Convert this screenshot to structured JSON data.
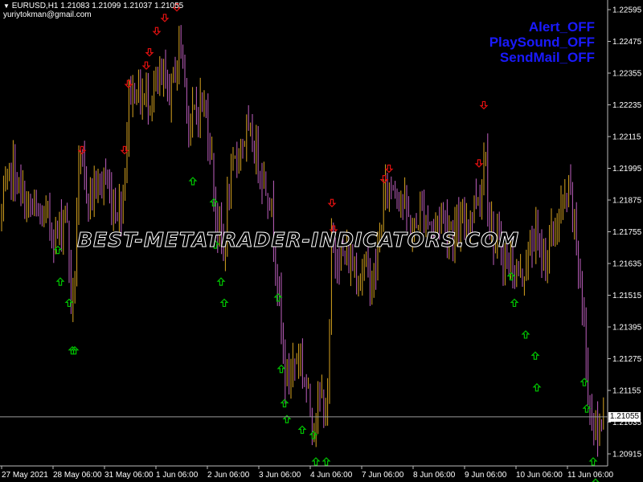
{
  "header": {
    "symbol_line": "EURUSD,H1  1.21083 1.21099 1.21037 1.21055",
    "account": "yuriytokman@gmail.com"
  },
  "alerts": {
    "alert": "Alert_OFF",
    "sound": "PlaySound_OFF",
    "mail": "SendMail_OFF"
  },
  "watermark": "BEST-METATRADER-INDICATORS.COM",
  "current_price": "1.21055",
  "colors": {
    "background": "#000000",
    "bull": "#d9a520",
    "bear": "#c060c0",
    "up_arrow": "#00c000",
    "down_arrow": "#e01010",
    "alert_text": "#1a1aff",
    "price_line": "#9a9a9a"
  },
  "chart_data": {
    "type": "candlestick",
    "symbol": "EURUSD",
    "timeframe": "H1",
    "ylim": [
      1.2085,
      1.2265
    ],
    "price_ticks": [
      "1.22595",
      "1.22475",
      "1.22355",
      "1.22235",
      "1.22115",
      "1.21995",
      "1.21875",
      "1.21755",
      "1.21635",
      "1.21515",
      "1.21395",
      "1.21275",
      "1.21155",
      "1.21035",
      "1.20915"
    ],
    "x_ticks": [
      "27 May 2021",
      "28 May 06:00",
      "31 May 06:00",
      "1 Jun 06:00",
      "2 Jun 06:00",
      "3 Jun 06:00",
      "4 Jun 06:00",
      "7 Jun 06:00",
      "8 Jun 06:00",
      "9 Jun 06:00",
      "10 Jun 06:00",
      "11 Jun 06:00"
    ],
    "close_path": [
      [
        0,
        1.218
      ],
      [
        8,
        1.219
      ],
      [
        15,
        1.22
      ],
      [
        25,
        1.219
      ],
      [
        35,
        1.2185
      ],
      [
        48,
        1.2181
      ],
      [
        60,
        1.218
      ],
      [
        70,
        1.2174
      ],
      [
        76,
        1.2178
      ],
      [
        81,
        1.2187
      ],
      [
        86,
        1.2165
      ],
      [
        90,
        1.2143
      ],
      [
        93,
        1.216
      ],
      [
        97,
        1.2196
      ],
      [
        102,
        1.2199
      ],
      [
        110,
        1.219
      ],
      [
        120,
        1.2192
      ],
      [
        130,
        1.2196
      ],
      [
        140,
        1.2186
      ],
      [
        150,
        1.2184
      ],
      [
        156,
        1.22
      ],
      [
        160,
        1.2228
      ],
      [
        170,
        1.223
      ],
      [
        178,
        1.2225
      ],
      [
        188,
        1.2228
      ],
      [
        196,
        1.223
      ],
      [
        204,
        1.2232
      ],
      [
        212,
        1.2228
      ],
      [
        220,
        1.224
      ],
      [
        226,
        1.2248
      ],
      [
        230,
        1.2232
      ],
      [
        236,
        1.2214
      ],
      [
        242,
        1.222
      ],
      [
        250,
        1.2225
      ],
      [
        258,
        1.2218
      ],
      [
        264,
        1.22
      ],
      [
        268,
        1.2184
      ],
      [
        272,
        1.2176
      ],
      [
        278,
        1.2168
      ],
      [
        284,
        1.2188
      ],
      [
        290,
        1.2198
      ],
      [
        298,
        1.2208
      ],
      [
        306,
        1.2212
      ],
      [
        316,
        1.2208
      ],
      [
        326,
        1.2198
      ],
      [
        336,
        1.2188
      ],
      [
        344,
        1.2164
      ],
      [
        350,
        1.2137
      ],
      [
        356,
        1.2119
      ],
      [
        364,
        1.2125
      ],
      [
        372,
        1.213
      ],
      [
        380,
        1.2118
      ],
      [
        388,
        1.2106
      ],
      [
        394,
        1.2106
      ],
      [
        400,
        1.2114
      ],
      [
        404,
        1.2108
      ],
      [
        408,
        1.2108
      ],
      [
        412,
        1.217
      ],
      [
        418,
        1.2168
      ],
      [
        426,
        1.2166
      ],
      [
        436,
        1.2164
      ],
      [
        446,
        1.216
      ],
      [
        456,
        1.2162
      ],
      [
        464,
        1.2156
      ],
      [
        470,
        1.2166
      ],
      [
        476,
        1.2186
      ],
      [
        482,
        1.2192
      ],
      [
        490,
        1.2194
      ],
      [
        498,
        1.219
      ],
      [
        508,
        1.218
      ],
      [
        516,
        1.2174
      ],
      [
        522,
        1.2184
      ],
      [
        530,
        1.2182
      ],
      [
        540,
        1.2176
      ],
      [
        548,
        1.2184
      ],
      [
        556,
        1.2178
      ],
      [
        564,
        1.2176
      ],
      [
        572,
        1.2176
      ],
      [
        580,
        1.218
      ],
      [
        588,
        1.2184
      ],
      [
        594,
        1.219
      ],
      [
        600,
        1.2192
      ],
      [
        604,
        1.2214
      ],
      [
        608,
        1.218
      ],
      [
        616,
        1.2172
      ],
      [
        624,
        1.2168
      ],
      [
        632,
        1.2164
      ],
      [
        640,
        1.2162
      ],
      [
        648,
        1.2158
      ],
      [
        654,
        1.2164
      ],
      [
        660,
        1.2168
      ],
      [
        666,
        1.2176
      ],
      [
        672,
        1.2166
      ],
      [
        680,
        1.2168
      ],
      [
        690,
        1.2176
      ],
      [
        700,
        1.2184
      ],
      [
        708,
        1.219
      ],
      [
        714,
        1.218
      ],
      [
        720,
        1.2162
      ],
      [
        726,
        1.2142
      ],
      [
        732,
        1.2114
      ],
      [
        738,
        1.2104
      ],
      [
        744,
        1.2097
      ],
      [
        748,
        1.2105
      ],
      [
        752,
        1.2112
      ]
    ],
    "up_arrows": [
      [
        72,
        1.217
      ],
      [
        75,
        1.2158
      ],
      [
        86,
        1.215
      ],
      [
        90,
        1.2132
      ],
      [
        93,
        1.2132
      ],
      [
        240,
        1.2196
      ],
      [
        266,
        1.2188
      ],
      [
        268,
        1.2172
      ],
      [
        275,
        1.2158
      ],
      [
        279,
        1.215
      ],
      [
        346,
        1.2152
      ],
      [
        350,
        1.2125
      ],
      [
        354,
        1.2112
      ],
      [
        357,
        1.2106
      ],
      [
        376,
        1.2102
      ],
      [
        390,
        1.21
      ],
      [
        393,
        1.209
      ],
      [
        406,
        1.209
      ],
      [
        636,
        1.216
      ],
      [
        640,
        1.215
      ],
      [
        654,
        1.2138
      ],
      [
        666,
        1.213
      ],
      [
        668,
        1.2118
      ],
      [
        727,
        1.212
      ],
      [
        730,
        1.211
      ],
      [
        738,
        1.209
      ],
      [
        741,
        1.2082
      ]
    ],
    "down_arrows": [
      [
        102,
        1.2205
      ],
      [
        155,
        1.2205
      ],
      [
        160,
        1.223
      ],
      [
        182,
        1.2237
      ],
      [
        186,
        1.2242
      ],
      [
        195,
        1.225
      ],
      [
        205,
        1.2255
      ],
      [
        220,
        1.2259
      ],
      [
        223,
        1.2265
      ],
      [
        413,
        1.2185
      ],
      [
        415,
        1.2175
      ],
      [
        478,
        1.2194
      ],
      [
        484,
        1.2198
      ],
      [
        596,
        1.22
      ],
      [
        602,
        1.2222
      ]
    ],
    "current_price": 1.21055
  }
}
